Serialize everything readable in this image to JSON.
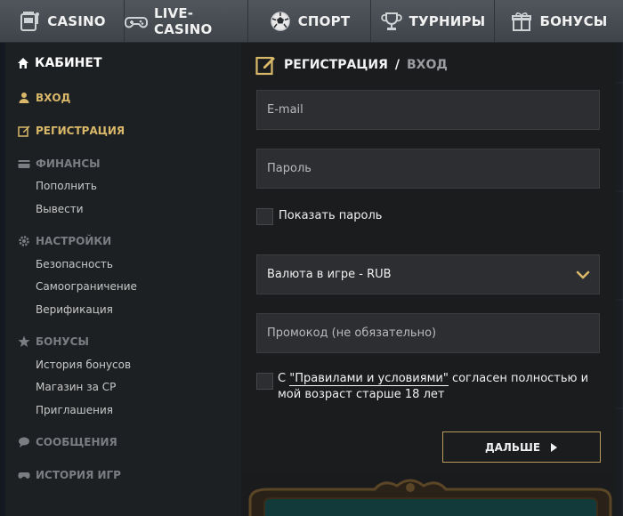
{
  "topnav": {
    "items": [
      {
        "label": "CASINO",
        "icon": "slot-machine-icon"
      },
      {
        "label": "LIVE-CASINO",
        "icon": "gamepad-icon"
      },
      {
        "label": "СПОРТ",
        "icon": "soccer-ball-icon"
      },
      {
        "label": "ТУРНИРЫ",
        "icon": "trophy-icon"
      },
      {
        "label": "БОНУСЫ",
        "icon": "gift-icon"
      }
    ]
  },
  "sidebar": {
    "header": "КАБИНЕТ",
    "login": "ВХОД",
    "registration": "РЕГИСТРАЦИЯ",
    "finances": {
      "label": "ФИНАНСЫ",
      "items": [
        "Пополнить",
        "Вывести"
      ]
    },
    "settings": {
      "label": "НАСТРОЙКИ",
      "items": [
        "Безопасность",
        "Самоограничение",
        "Верификация"
      ]
    },
    "bonuses": {
      "label": "БОНУСЫ",
      "items": [
        "История бонусов",
        "Магазин за CP",
        "Приглашения"
      ]
    },
    "messages": "СООБЩЕНИЯ",
    "game_history": "ИСТОРИЯ ИГР"
  },
  "form": {
    "title": "РЕГИСТРАЦИЯ",
    "separator": "/",
    "login_link": "ВХОД",
    "email_placeholder": "E-mail",
    "password_placeholder": "Пароль",
    "show_password": "Показать пароль",
    "currency": "Валюта в игре - RUB",
    "promo_placeholder": "Промокод (не обязательно)",
    "terms_prefix": "С ",
    "terms_link": "\"Правилами и условиями\"",
    "terms_suffix": " согласен полностью и мой возраст старше 18 лет",
    "next_button": "ДАЛЬШЕ"
  },
  "colors": {
    "accent_gold": "#d9b86a",
    "button_border": "#b89b5a",
    "topnav_bg": "#474d52",
    "sidebar_bg": "#1d2022",
    "panel_bg": "#1b1c1e",
    "field_bg": "#2c2e31"
  }
}
